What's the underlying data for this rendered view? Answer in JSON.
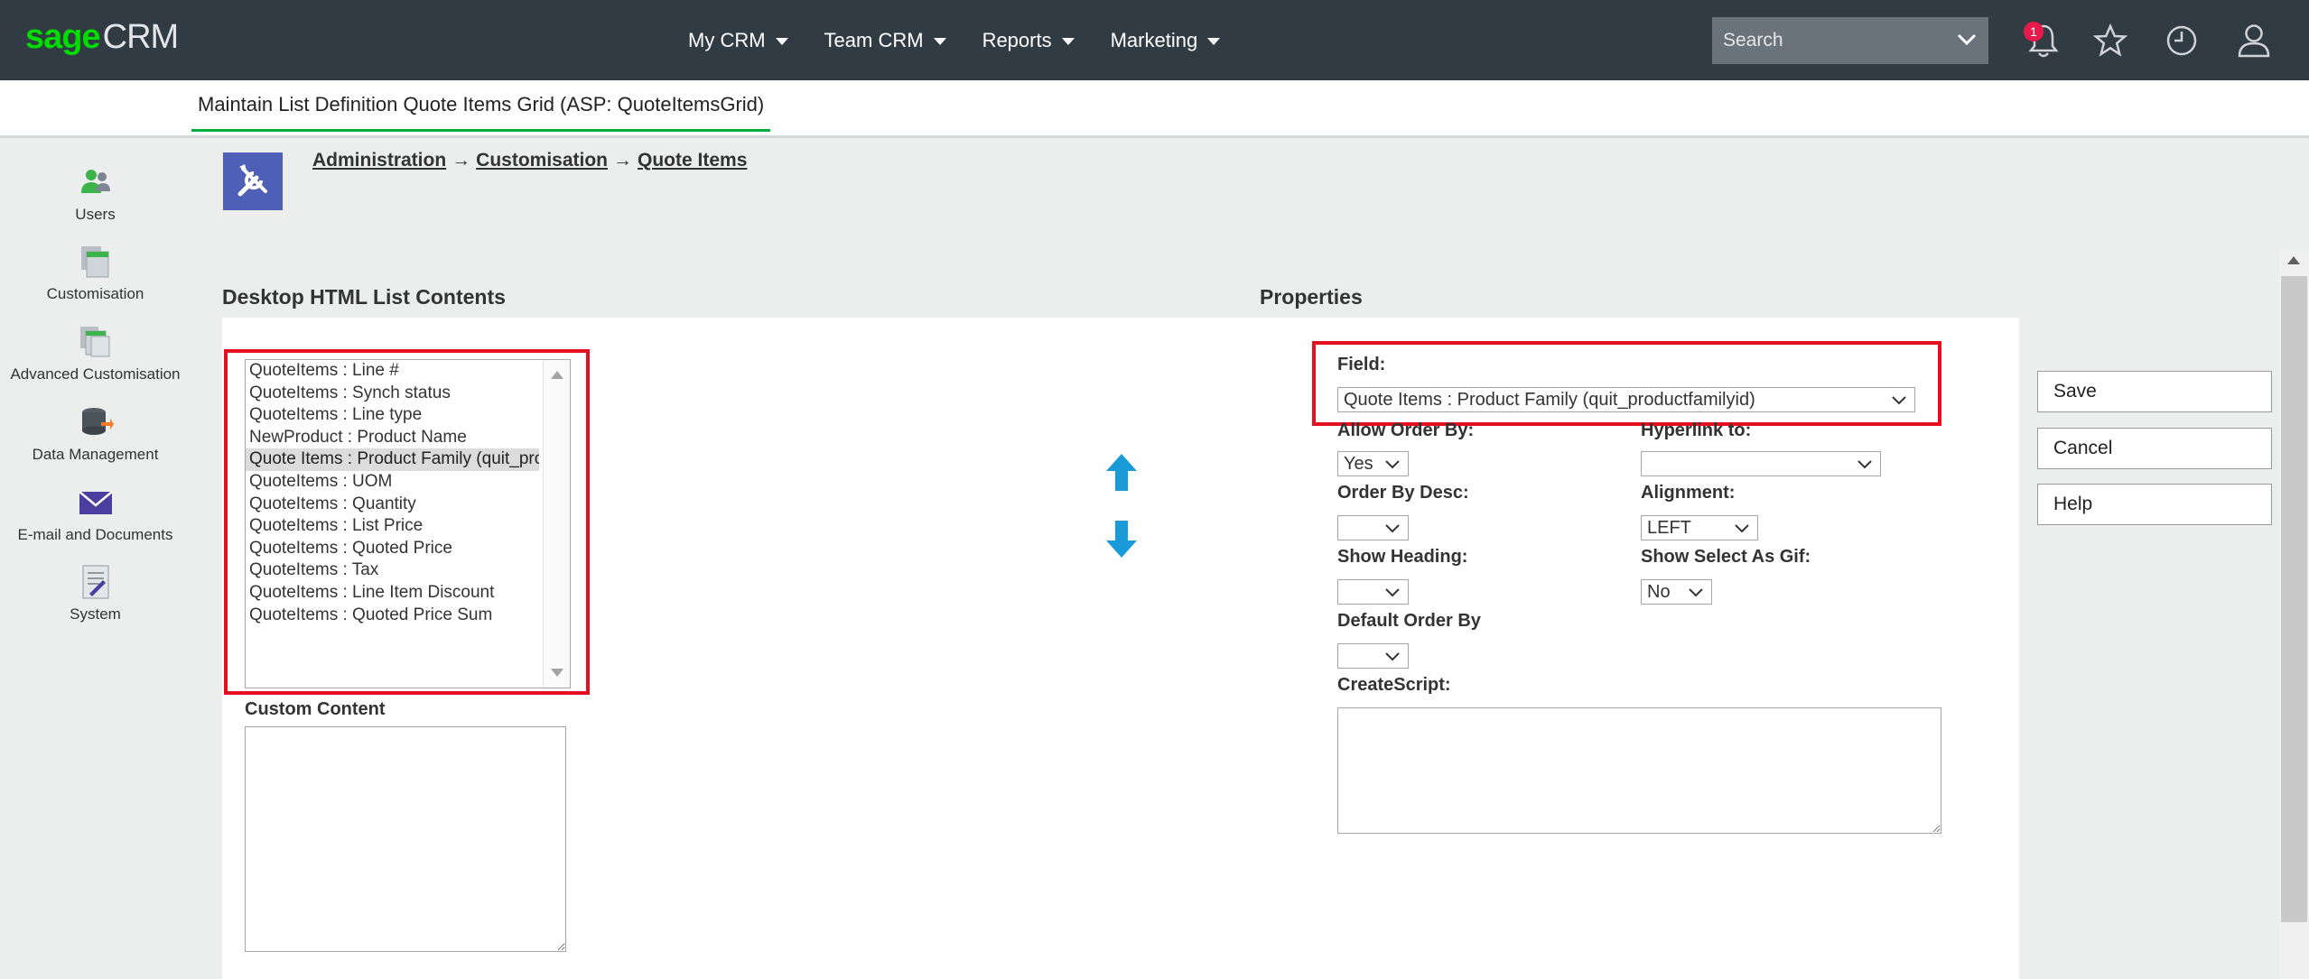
{
  "app": {
    "logo_brand": "sage",
    "logo_product": "CRM"
  },
  "topnav": {
    "items": [
      {
        "label": "My CRM"
      },
      {
        "label": "Team CRM"
      },
      {
        "label": "Reports"
      },
      {
        "label": "Marketing"
      }
    ],
    "search_placeholder": "Search",
    "notification_count": "1"
  },
  "page": {
    "title": "Maintain List Definition Quote Items Grid (ASP: QuoteItemsGrid)"
  },
  "sidebar": {
    "items": [
      {
        "label": "Users"
      },
      {
        "label": "Customisation"
      },
      {
        "label": "Advanced Customisation"
      },
      {
        "label": "Data Management"
      },
      {
        "label": "E-mail and Documents"
      },
      {
        "label": "System"
      }
    ]
  },
  "breadcrumb": {
    "items": [
      "Administration",
      "Customisation",
      "Quote Items"
    ],
    "separator": "→"
  },
  "list_contents": {
    "heading": "Desktop HTML List Contents",
    "items": [
      "QuoteItems : Line #",
      "QuoteItems : Synch status",
      "QuoteItems : Line type",
      "NewProduct : Product Name",
      "Quote Items : Product Family (quit_productfamilyid)",
      "QuoteItems : UOM",
      "QuoteItems : Quantity",
      "QuoteItems : List Price",
      "QuoteItems : Quoted Price",
      "QuoteItems : Tax",
      "QuoteItems : Line Item Discount",
      "QuoteItems : Quoted Price Sum"
    ],
    "selected_index": 4,
    "custom_content_label": "Custom Content"
  },
  "properties": {
    "heading": "Properties",
    "field_label": "Field:",
    "field_value": "Quote Items : Product Family (quit_productfamilyid)",
    "allow_order_by_label": "Allow Order By:",
    "allow_order_by_value": "Yes",
    "hyperlink_to_label": "Hyperlink to:",
    "hyperlink_to_value": "",
    "order_by_desc_label": "Order By Desc:",
    "order_by_desc_value": "",
    "alignment_label": "Alignment:",
    "alignment_value": "LEFT",
    "show_heading_label": "Show Heading:",
    "show_heading_value": "",
    "show_select_as_gif_label": "Show Select As Gif:",
    "show_select_as_gif_value": "No",
    "default_order_by_label": "Default Order By",
    "default_order_by_value": "",
    "create_script_label": "CreateScript:"
  },
  "actions": {
    "save_label": "Save",
    "cancel_label": "Cancel",
    "help_label": "Help"
  },
  "colors": {
    "topbar": "#313b44",
    "brand_green": "#00dc00",
    "highlight_red": "#e3101f",
    "arrow_blue": "#1a9ad6",
    "admin_icon_bg": "#4d5fb7"
  }
}
